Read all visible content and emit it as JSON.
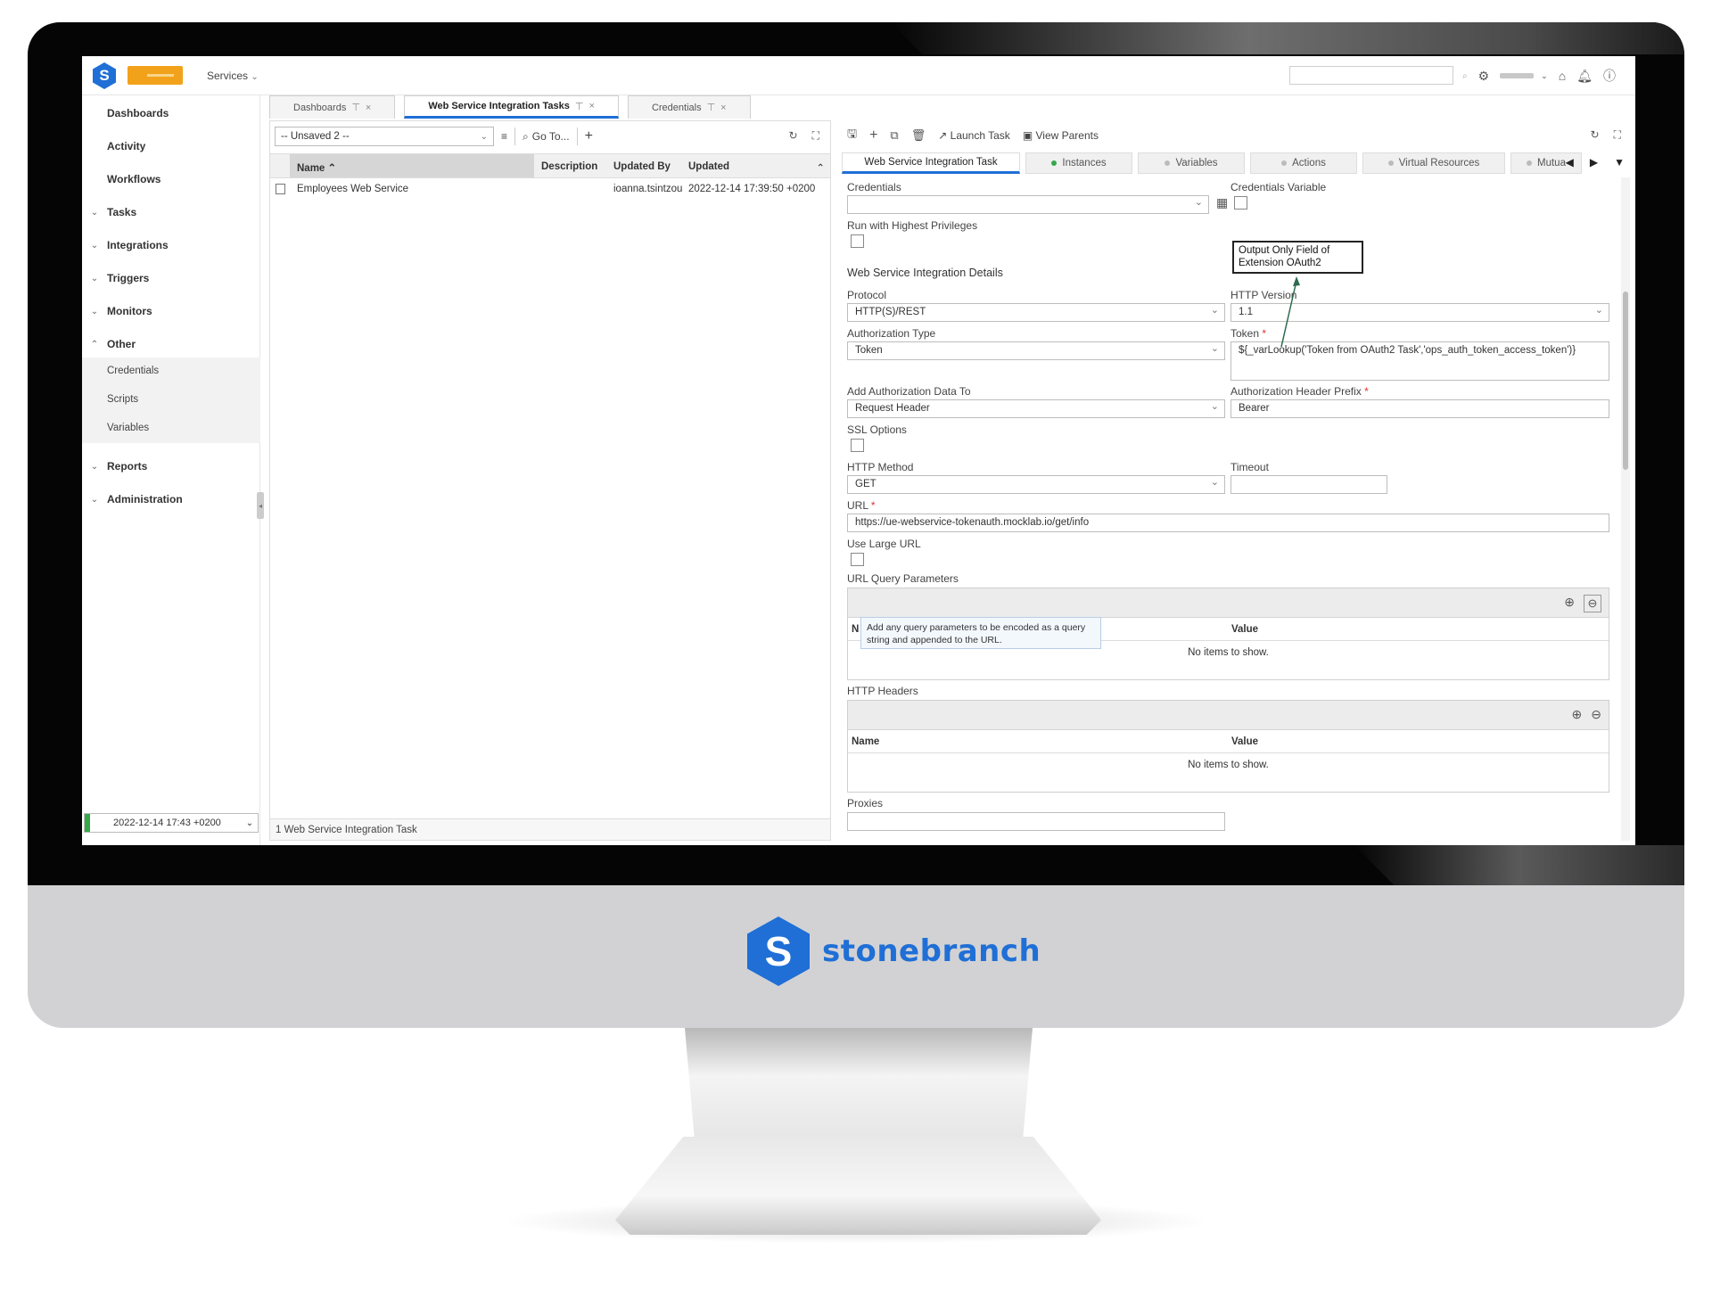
{
  "topbar": {
    "services_label": "Services",
    "services_chevron": "⌄"
  },
  "sidebar": {
    "items": {
      "dashboards": "Dashboards",
      "activity": "Activity",
      "workflows": "Workflows",
      "tasks": "Tasks",
      "integrations": "Integrations",
      "triggers": "Triggers",
      "monitors": "Monitors",
      "other": "Other",
      "reports": "Reports",
      "administration": "Administration"
    },
    "other_sub": {
      "credentials": "Credentials",
      "scripts": "Scripts",
      "variables": "Variables"
    },
    "footer_datetime": "2022-12-14 17:43 +0200"
  },
  "doc_tabs": {
    "dashboards": "Dashboards",
    "ws_tasks": "Web Service Integration Tasks",
    "credentials": "Credentials",
    "pin": "⊤",
    "close": "×"
  },
  "list": {
    "filter_value": "-- Unsaved 2 --",
    "goto_label": "Go To...",
    "columns": {
      "name": "Name",
      "description": "Description",
      "updated_by": "Updated By",
      "updated": "Updated"
    },
    "rows": [
      {
        "name": "Employees Web Service",
        "description": "",
        "updated_by": "ioanna.tsintzou",
        "updated": "2022-12-14 17:39:50 +0200"
      }
    ],
    "footer": "1 Web Service Integration Task"
  },
  "detail": {
    "toolbar": {
      "launch_task": "Launch Task",
      "view_parents": "View Parents"
    },
    "tabs": {
      "main": "Web Service Integration Task",
      "instances": "Instances",
      "variables": "Variables",
      "actions": "Actions",
      "virtual_resources": "Virtual Resources",
      "mutual": "Mutua"
    },
    "form": {
      "credentials_label": "Credentials",
      "credentials_variable_label": "Credentials Variable",
      "run_highest_label": "Run with Highest Privileges",
      "section_title": "Web Service Integration Details",
      "protocol_label": "Protocol",
      "protocol_value": "HTTP(S)/REST",
      "http_version_label": "HTTP Version",
      "http_version_value": "1.1",
      "auth_type_label": "Authorization Type",
      "auth_type_value": "Token",
      "token_label": "Token",
      "token_value": "${_varLookup('Token from OAuth2 Task','ops_auth_token_access_token')}",
      "add_auth_label": "Add Authorization Data To",
      "add_auth_value": "Request Header",
      "auth_prefix_label": "Authorization Header Prefix",
      "auth_prefix_value": "Bearer",
      "ssl_label": "SSL Options",
      "http_method_label": "HTTP Method",
      "http_method_value": "GET",
      "timeout_label": "Timeout",
      "url_label": "URL",
      "url_value": "https://ue-webservice-tokenauth.mocklab.io/get/info",
      "large_url_label": "Use Large URL",
      "query_params_label": "URL Query Parameters",
      "query_tooltip": "Add any query parameters to be encoded as a query string and appended to the URL.",
      "col_name_trunc": "N",
      "col_value": "Value",
      "no_items": "No items to show.",
      "headers_label": "HTTP Headers",
      "col_name": "Name",
      "proxies_label": "Proxies"
    }
  },
  "callout": {
    "text": "Output Only Field of Extension OAuth2"
  },
  "brand": {
    "letter": "S",
    "name": "stonebranch"
  }
}
